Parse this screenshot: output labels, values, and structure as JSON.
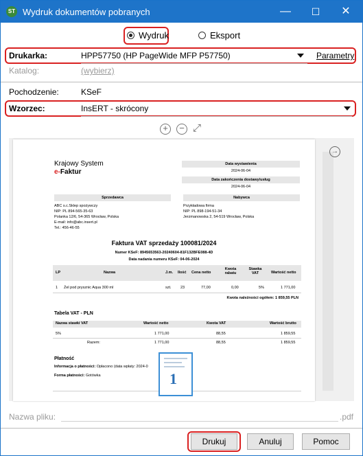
{
  "window": {
    "app_icon_text": "ST",
    "title": "Wydruk dokumentów pobranych",
    "minimize": "—",
    "maximize": "☐",
    "close": "✕"
  },
  "mode": {
    "print_label": "Wydruk",
    "export_label": "Eksport",
    "selected": "Wydruk"
  },
  "form": {
    "printer_label": "Drukarka:",
    "printer_value": "HPP57750 (HP PageWide MFP P57750)",
    "params_label": "Parametry",
    "catalog_label": "Katalog:",
    "catalog_value": "(wybierz)",
    "origin_label": "Pochodzenie:",
    "origin_value": "KSeF",
    "template_label": "Wzorzec:",
    "template_value": "InsERT - skrócony",
    "filename_label": "Nazwa pliku:",
    "filename_ext": ".pdf"
  },
  "preview": {
    "zoom_in": "+",
    "zoom_out": "−",
    "fit": "⤢",
    "next_page": "→",
    "thumb_page": "1",
    "doc": {
      "brand_line1": "Krajowy System",
      "brand_e": "e-",
      "brand_line2": "Faktur",
      "issue_date_label": "Data wystawienia",
      "issue_date": "2024-06-04",
      "delivery_date_label": "Data zakończenia dostawy/usług",
      "delivery_date": "2024-06-04",
      "seller_label": "Sprzedawca",
      "seller_lines": [
        "ABC s.c.Sklep spożywczy",
        "NIP: PL 894-565-35-63",
        "Polanka 12/6, 54-365 Wrocław, Polska",
        "E-mail: info@abc.insert.pl",
        "Tel.: 456-46-55"
      ],
      "buyer_label": "Nabywca",
      "buyer_lines": [
        "Przykładowa firma",
        "NIP: PL 898-194-51-34",
        "Jerzmanowska 2, 54-519 Wrocław, Polska"
      ],
      "invoice_title": "Faktura VAT sprzedaży 100081/2024",
      "ksef_number": "Numer KSeF: 8945653563-20240604-81F132BFE088-4D",
      "ksef_date": "Data nadania numeru KSeF: 04-06-2024",
      "items_headers": [
        "LP",
        "Nazwa",
        "J.m.",
        "Ilość",
        "Cena netto",
        "Kwota rabatu",
        "Stawka VAT",
        "Wartość netto"
      ],
      "items": [
        [
          "1",
          "Żel pod prysznic Aqua 300 ml",
          "szt.",
          "23",
          "77,00",
          "0,00",
          "5%",
          "1 771,00"
        ]
      ],
      "amount_due": "Kwota należności ogółem: 1 859,55 PLN",
      "vat_table_title": "Tabela VAT - PLN",
      "vat_headers": [
        "Nazwa stawki VAT",
        "Wartość netto",
        "Kwota VAT",
        "Wartość brutto"
      ],
      "vat_rows": [
        [
          "5%",
          "1 771,00",
          "88,55",
          "1 859,55"
        ],
        [
          "Razem:",
          "1 771,00",
          "88,55",
          "1 859,55"
        ]
      ],
      "payment_title": "Płatność",
      "payment_info_label": "Informacja o płatności:",
      "payment_info_value": "Opłacono (data wpłaty: 2024-0",
      "payment_form_label": "Forma płatności:",
      "payment_form_value": "Gotówka"
    }
  },
  "buttons": {
    "print": "Drukuj",
    "cancel": "Anuluj",
    "help": "Pomoc"
  },
  "colors": {
    "titlebar": "#1e74c9",
    "highlight": "#d92020"
  }
}
